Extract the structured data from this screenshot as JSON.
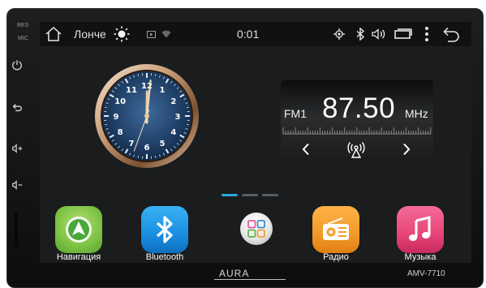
{
  "bezel": {
    "res_label": "RES",
    "mic_label": "MIC",
    "brand": "AURA",
    "model": "AMV-7710",
    "buttons": [
      {
        "name": "power-button",
        "icon": "power-icon"
      },
      {
        "name": "back-hw-button",
        "icon": "back-icon"
      },
      {
        "name": "volume-up-button",
        "icon": "volume-up-icon"
      },
      {
        "name": "volume-down-button",
        "icon": "volume-down-icon"
      }
    ]
  },
  "statusbar": {
    "launcher_label": "Лонче",
    "time": "0:01",
    "icons": [
      "home-icon",
      "brightness-icon",
      "media-play-icon",
      "wifi-icon",
      "gps-icon",
      "bluetooth-icon",
      "volume-icon",
      "window-icon",
      "overflow-menu-icon",
      "back-icon"
    ]
  },
  "clock": {
    "numerals": [
      "12",
      "1",
      "2",
      "3",
      "4",
      "5",
      "6",
      "7",
      "8",
      "9",
      "10",
      "11"
    ],
    "time": "0:01"
  },
  "radio": {
    "band": "FM1",
    "frequency": "87.50",
    "unit": "MHz",
    "icons": [
      "chevron-left-icon",
      "radio-tower-icon",
      "chevron-right-icon"
    ]
  },
  "pager": {
    "pages": 3,
    "active": 0
  },
  "dock": {
    "apps": [
      {
        "label": "Навигация",
        "icon": "navigation-icon",
        "color": "#7cc242"
      },
      {
        "label": "Bluetooth",
        "icon": "bluetooth-icon",
        "color": "#1a8fe0"
      },
      {
        "label": "",
        "icon": "app-grid-icon",
        "color": "#dcdcdc"
      },
      {
        "label": "Радио",
        "icon": "radio-icon",
        "color": "#f39c2b"
      },
      {
        "label": "Музыка",
        "icon": "music-icon",
        "color": "#e8487a"
      }
    ]
  },
  "colors": {
    "accent": "#2aa7e0",
    "screen_bg": "#1a1c1d",
    "statusbar_bg": "#0f1112"
  }
}
